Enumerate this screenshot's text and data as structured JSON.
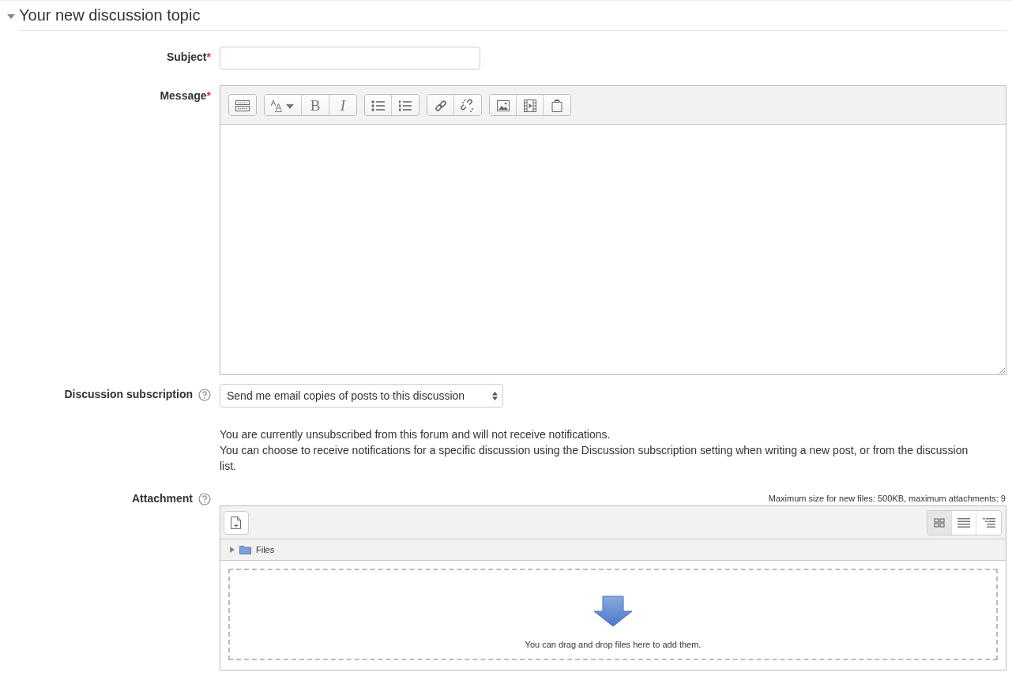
{
  "section": {
    "title": "Your new discussion topic",
    "expanded": true
  },
  "subject": {
    "label": "Subject",
    "required_mark": "*"
  },
  "message": {
    "label": "Message",
    "required_mark": "*",
    "toolbar": [
      [
        {
          "kind": "collapse"
        }
      ],
      [
        {
          "kind": "font"
        },
        {
          "kind": "bold",
          "label": "B"
        },
        {
          "kind": "italic",
          "label": "I"
        }
      ],
      [
        {
          "kind": "bullets"
        },
        {
          "kind": "numbers"
        }
      ],
      [
        {
          "kind": "link"
        },
        {
          "kind": "unlink"
        }
      ],
      [
        {
          "kind": "image"
        },
        {
          "kind": "media"
        },
        {
          "kind": "files"
        }
      ]
    ]
  },
  "subscription": {
    "label": "Discussion subscription",
    "value": "Send me email copies of posts to this discussion",
    "notes": [
      "You are currently unsubscribed from this forum and will not receive notifications.",
      "You can choose to receive notifications for a specific discussion using the Discussion subscription setting when writing a new post, or from the discussion list."
    ]
  },
  "attachment": {
    "label": "Attachment",
    "limits": "Maximum size for new files: 500KB, maximum attachments: 9",
    "views": [
      {
        "kind": "icons",
        "selected": true
      },
      {
        "kind": "list",
        "selected": false
      },
      {
        "kind": "tree",
        "selected": false
      }
    ],
    "folder": "Files",
    "drop_hint": "You can drag and drop files here to add them."
  }
}
